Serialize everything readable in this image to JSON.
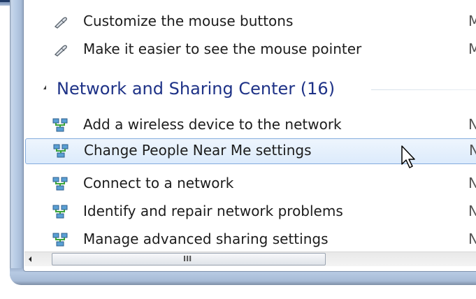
{
  "mouse_items": [
    {
      "label": "Customize the mouse buttons",
      "trail": "M"
    },
    {
      "label": "Make it easier to see the mouse pointer",
      "trail": "M"
    }
  ],
  "network_group": {
    "title": "Network and Sharing Center (16)",
    "items": [
      {
        "label": "Add a wireless device to the network",
        "trail": "N"
      },
      {
        "label": "Change People Near Me settings",
        "trail": "N"
      },
      {
        "label": "Connect to a network",
        "trail": "N"
      },
      {
        "label": "Identify and repair network problems",
        "trail": "N"
      },
      {
        "label": "Manage advanced sharing settings",
        "trail": "N"
      }
    ]
  },
  "scrollbar": {
    "grip": "III"
  },
  "icons": {
    "mouse": "mouse-icon",
    "network": "network-icon",
    "cursor": "pointer-cursor-icon"
  }
}
